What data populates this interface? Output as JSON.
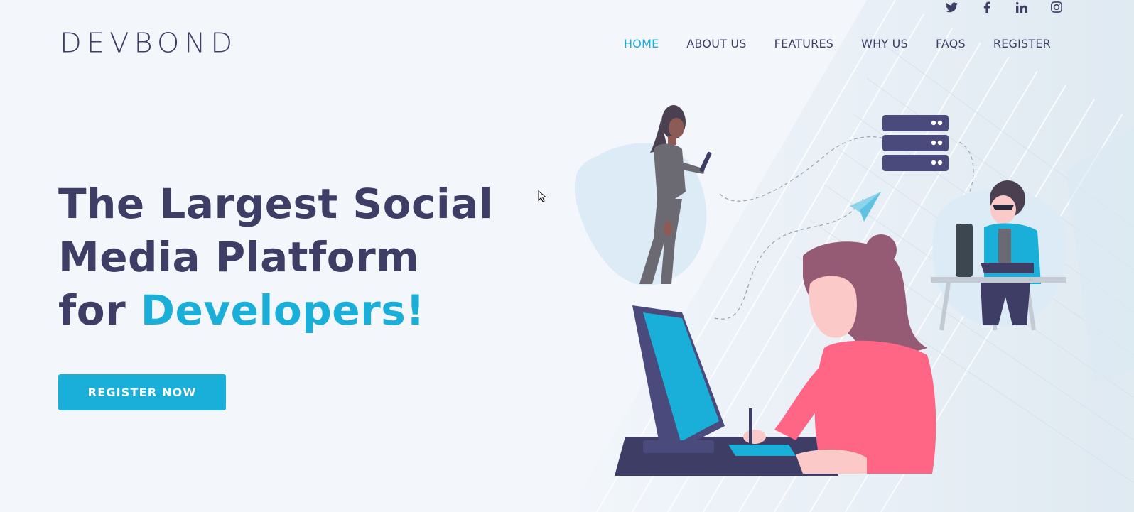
{
  "brand": {
    "logo_text": "DEVBOND"
  },
  "social": {
    "icons": [
      "twitter-icon",
      "facebook-icon",
      "linkedin-icon",
      "instagram-icon"
    ]
  },
  "nav": {
    "items": [
      {
        "label": "HOME",
        "active": true
      },
      {
        "label": "ABOUT US",
        "active": false
      },
      {
        "label": "FEATURES",
        "active": false
      },
      {
        "label": "WHY US",
        "active": false
      },
      {
        "label": "FAQS",
        "active": false
      },
      {
        "label": "REGISTER",
        "active": false
      }
    ]
  },
  "hero": {
    "line1": "The Largest Social",
    "line2": "Media Platform",
    "line3_prefix": "for",
    "line3_accent": "Developers!",
    "cta_label": "REGISTER NOW"
  },
  "colors": {
    "accent": "#1aafd8",
    "text": "#3d3d66",
    "background": "#f3f7fc",
    "shirt": "#ff6584"
  }
}
